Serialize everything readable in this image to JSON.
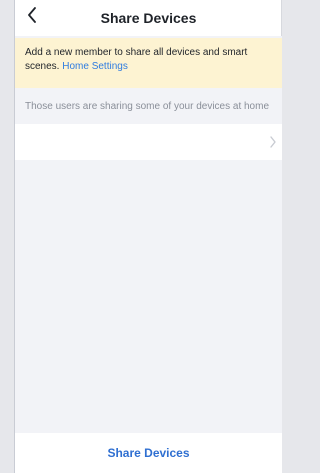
{
  "header": {
    "title": "Share Devices"
  },
  "banner": {
    "text": "Add a new member to share all devices and smart scenes.",
    "link_label": "Home Settings"
  },
  "section": {
    "info_text": "Those users are sharing some of your devices at home"
  },
  "footer": {
    "share_label": "Share Devices"
  },
  "colors": {
    "accent": "#2f6fd1",
    "link": "#2f7ce0",
    "banner_bg": "#fdf3d2",
    "page_bg": "#f2f3f7"
  },
  "icons": {
    "back": "chevron-left-icon",
    "row_chevron": "chevron-right-icon"
  }
}
